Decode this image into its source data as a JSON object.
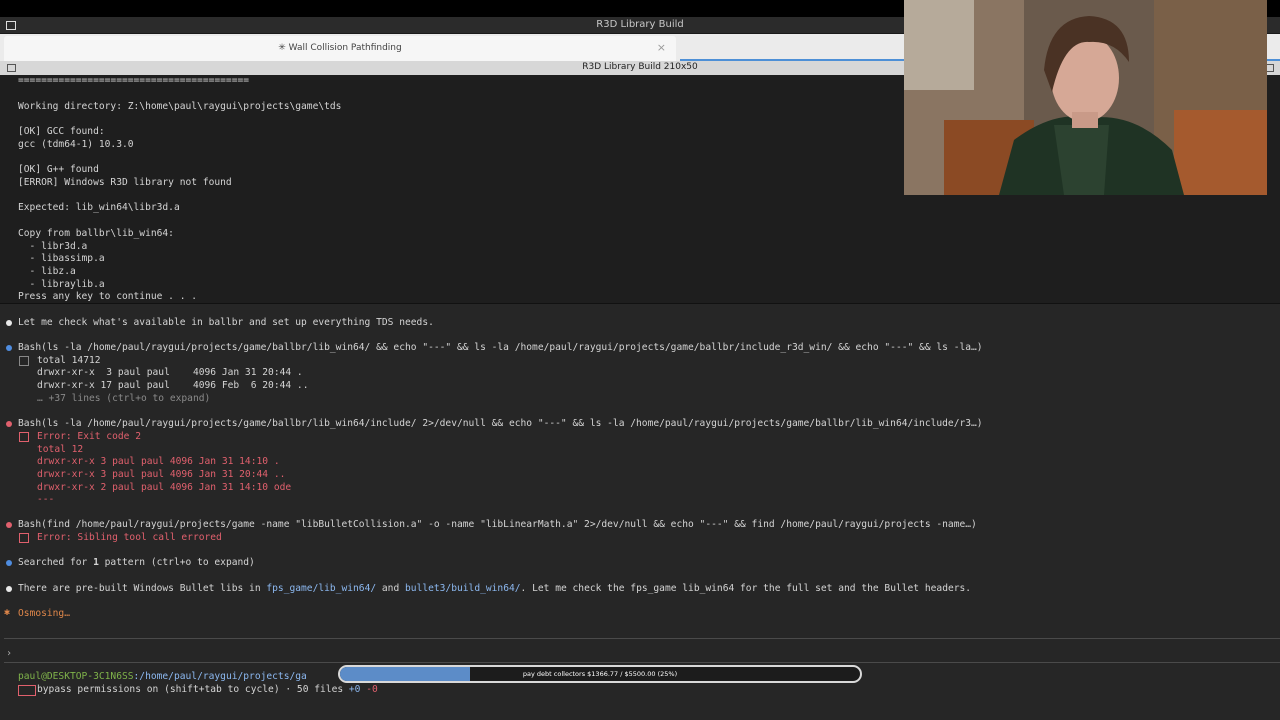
{
  "window": {
    "title": "R3D Library Build",
    "terminal_title": "R3D Library Build 210x50"
  },
  "tab": {
    "label": "✳ Wall Collision Pathfinding",
    "close": "×"
  },
  "cmd_output": {
    "lines": [
      "========================================",
      "",
      "Working directory: Z:\\home\\paul\\raygui\\projects\\game\\tds",
      "",
      "[OK] GCC found:",
      "gcc (tdm64-1) 10.3.0",
      "",
      "[OK] G++ found",
      "[ERROR] Windows R3D library not found",
      "",
      "Expected: lib_win64\\libr3d.a",
      "",
      "Copy from ballbr\\lib_win64:",
      "  - libr3d.a",
      "  - libassimp.a",
      "  - libz.a",
      "  - libraylib.a",
      "Press any key to continue . . ."
    ]
  },
  "transcript": {
    "msg1": "Let me check what's available in ballbr and set up everything TDS needs.",
    "bash1": {
      "cmd": "Bash(ls -la /home/paul/raygui/projects/game/ballbr/lib_win64/ && echo \"---\" && ls -la /home/paul/raygui/projects/game/ballbr/include_r3d_win/ && echo \"---\" && ls -la…)",
      "out": [
        "total 14712",
        "drwxr-xr-x  3 paul paul    4096 Jan 31 20:44 .",
        "drwxr-xr-x 17 paul paul    4096 Feb  6 20:44 .."
      ],
      "more": "… +37 lines (ctrl+o to expand)"
    },
    "bash2": {
      "cmd": "Bash(ls -la /home/paul/raygui/projects/game/ballbr/lib_win64/include/ 2>/dev/null && echo \"---\" && ls -la /home/paul/raygui/projects/game/ballbr/lib_win64/include/r3…)",
      "err": [
        "Error: Exit code 2",
        "total 12",
        "drwxr-xr-x 3 paul paul 4096 Jan 31 14:10 .",
        "drwxr-xr-x 3 paul paul 4096 Jan 31 20:44 ..",
        "drwxr-xr-x 2 paul paul 4096 Jan 31 14:10 ode",
        "---"
      ]
    },
    "bash3": {
      "cmd": "Bash(find /home/paul/raygui/projects/game -name \"libBulletCollision.a\" -o -name \"libLinearMath.a\" 2>/dev/null && echo \"---\" && find /home/paul/raygui/projects -name…)",
      "err": "Error: Sibling tool call errored"
    },
    "search": {
      "prefix": "Searched for ",
      "count": "1",
      "suffix": " pattern (ctrl+o to expand)"
    },
    "msg2": {
      "a": "There are pre-built Windows Bullet libs in ",
      "path1": "fps_game/lib_win64/",
      "b": " and ",
      "path2": "bullet3/build_win64/",
      "c": ". Let me check the fps_game lib_win64 for the full set and the Bullet headers."
    },
    "status": "Osmosing…"
  },
  "prompt": {
    "caret": "›"
  },
  "statusline": {
    "user": "paul@DESKTOP-3C1N6SS",
    "path": ":/home/paul/raygui/projects/ga",
    "mode": "bypass permissions on (shift+tab to cycle) · 50 files ",
    "diff_add": "+0",
    "diff_del": "-0"
  },
  "progress": {
    "text": "pay debt collectors $1366.77 / $5500.00 (25%)",
    "fraction": 0.25
  },
  "colors": {
    "accent": "#4f8de0",
    "error": "#e0606d",
    "success": "#7fb34a",
    "working": "#e0874a"
  }
}
